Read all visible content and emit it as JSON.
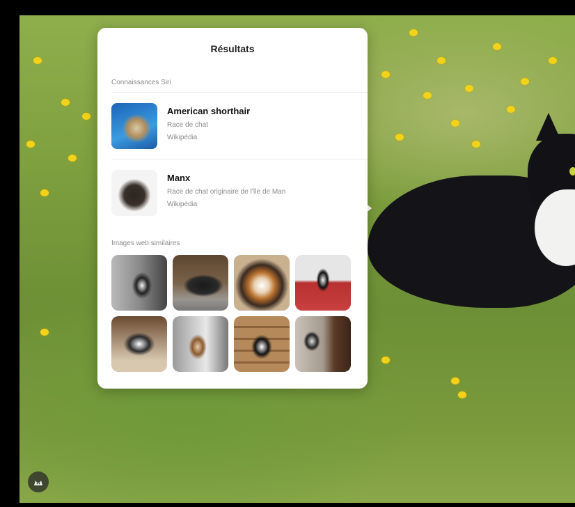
{
  "popup": {
    "title": "Résultats",
    "knowledge_section": "Connaissances Siri",
    "results": [
      {
        "title": "American shorthair",
        "subtitle": "Race de chat",
        "source": "Wikipédia"
      },
      {
        "title": "Manx",
        "subtitle": "Race de chat originaire de l'île de Man",
        "source": "Wikipédia"
      }
    ],
    "similar_section": "Images web similaires"
  },
  "icons": {
    "visual_lookup": "cat-paw-lookup-icon"
  }
}
